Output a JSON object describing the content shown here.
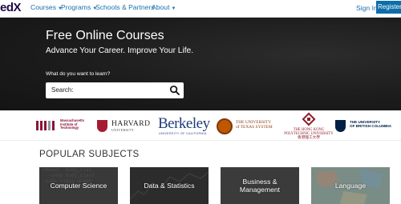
{
  "nav": {
    "logo_text": "edX",
    "items": [
      {
        "label": "Courses"
      },
      {
        "label": "Programs"
      },
      {
        "label": "Schools & Partners"
      },
      {
        "label": "About"
      }
    ],
    "signin_label": "Sign In",
    "register_label": "Register"
  },
  "hero": {
    "title": "Free Online Courses",
    "subtitle": "Advance Your Career. Improve Your Life.",
    "search_label": "What do you want to learn?",
    "search_prefix": "Search:",
    "search_value": ""
  },
  "partners": {
    "mit": {
      "text": "Massachusetts\nInstitute of\nTechnology"
    },
    "harvard": {
      "name": "HARVARD",
      "sub": "UNIVERSITY"
    },
    "berkeley": {
      "name": "Berkeley",
      "sub": "UNIVERSITY OF CALIFORNIA"
    },
    "texas": {
      "text": "THE UNIVERSITY\nof TEXAS SYSTEM"
    },
    "hkpolyu": {
      "text": "THE HONG KONG\nPOLYTECHNIC UNIVERSITY\n香港理工大學"
    },
    "ubc": {
      "text": "THE UNIVERSITY\nOF BRITISH COLUMBIA"
    }
  },
  "subjects": {
    "title": "POPULAR SUBJECTS",
    "tiles": [
      {
        "label": "Computer Science",
        "color": "#3a3a3a"
      },
      {
        "label": "Data & Statistics",
        "color": "#2e2e2e"
      },
      {
        "label": "Business &\nManagement",
        "color": "#3d3d3d"
      },
      {
        "label": "Language",
        "color": "#7e8a86"
      }
    ]
  },
  "colors": {
    "brand_blue": "#0d6ea8",
    "link_blue": "#1b6fae",
    "hero_bg": "#1c1c1c"
  }
}
